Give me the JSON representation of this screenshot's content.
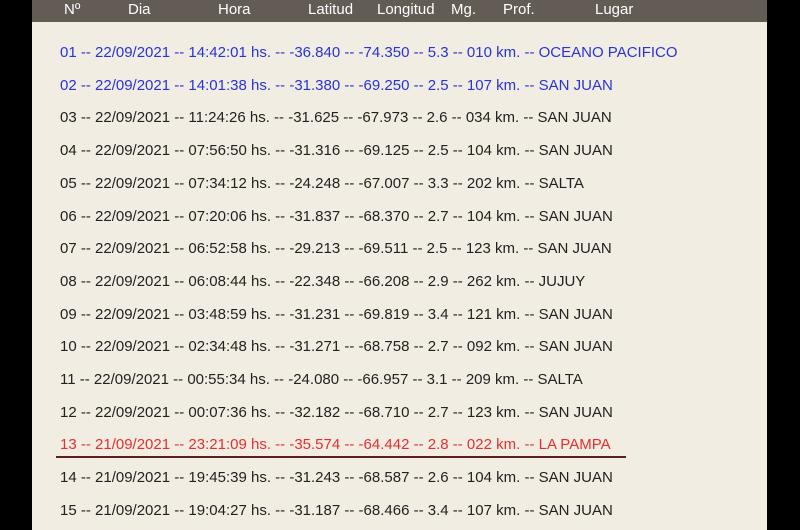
{
  "header": {
    "col_num": "Nº",
    "col_day": "Dia",
    "col_time": "Hora",
    "col_lat": "Latitud",
    "col_lon": "Longitud",
    "col_mag": "Mg.",
    "col_depth": "Prof.",
    "col_place": "Lugar"
  },
  "colors": {
    "header_bg": "#625c55",
    "page_bg": "#f1ede3",
    "highlight_blue": "#2a33d6",
    "highlight_red": "#e2302f",
    "text": "#222222"
  },
  "rows": [
    {
      "num": "01",
      "date": "22/09/2021",
      "time": "14:42:01",
      "lat": "-36.840",
      "lon": "-74.350",
      "mag": "5.3",
      "depth": "010",
      "place": "OCEANO PACIFICO",
      "style": "blue"
    },
    {
      "num": "02",
      "date": "22/09/2021",
      "time": "14:01:38",
      "lat": "-31.380",
      "lon": "-69.250",
      "mag": "2.5",
      "depth": "107",
      "place": "SAN JUAN",
      "style": "blue"
    },
    {
      "num": "03",
      "date": "22/09/2021",
      "time": "11:24:26",
      "lat": "-31.625",
      "lon": "-67.973",
      "mag": "2.6",
      "depth": "034",
      "place": "SAN JUAN",
      "style": "normal"
    },
    {
      "num": "04",
      "date": "22/09/2021",
      "time": "07:56:50",
      "lat": "-31.316",
      "lon": "-69.125",
      "mag": "2.5",
      "depth": "104",
      "place": "SAN JUAN",
      "style": "normal"
    },
    {
      "num": "05",
      "date": "22/09/2021",
      "time": "07:34:12",
      "lat": "-24.248",
      "lon": "-67.007",
      "mag": "3.3",
      "depth": "202",
      "place": "SALTA",
      "style": "normal"
    },
    {
      "num": "06",
      "date": "22/09/2021",
      "time": "07:20:06",
      "lat": "-31.837",
      "lon": "-68.370",
      "mag": "2.7",
      "depth": "104",
      "place": "SAN JUAN",
      "style": "normal"
    },
    {
      "num": "07",
      "date": "22/09/2021",
      "time": "06:52:58",
      "lat": "-29.213",
      "lon": "-69.511",
      "mag": "2.5",
      "depth": "123",
      "place": "SAN JUAN",
      "style": "normal"
    },
    {
      "num": "08",
      "date": "22/09/2021",
      "time": "06:08:44",
      "lat": "-22.348",
      "lon": "-66.208",
      "mag": "2.9",
      "depth": "262",
      "place": "JUJUY",
      "style": "normal"
    },
    {
      "num": "09",
      "date": "22/09/2021",
      "time": "03:48:59",
      "lat": "-31.231",
      "lon": "-69.819",
      "mag": "3.4",
      "depth": "121",
      "place": "SAN JUAN",
      "style": "normal"
    },
    {
      "num": "10",
      "date": "22/09/2021",
      "time": "02:34:48",
      "lat": "-31.271",
      "lon": "-68.758",
      "mag": "2.7",
      "depth": "092",
      "place": "SAN JUAN",
      "style": "normal"
    },
    {
      "num": "11",
      "date": "22/09/2021",
      "time": "00:55:34",
      "lat": "-24.080",
      "lon": "-66.957",
      "mag": "3.1",
      "depth": "209",
      "place": "SALTA",
      "style": "normal"
    },
    {
      "num": "12",
      "date": "22/09/2021",
      "time": "00:07:36",
      "lat": "-32.182",
      "lon": "-68.710",
      "mag": "2.7",
      "depth": "123",
      "place": "SAN JUAN",
      "style": "normal"
    },
    {
      "num": "13",
      "date": "21/09/2021",
      "time": "23:21:09",
      "lat": "-35.574",
      "lon": "-64.442",
      "mag": "2.8",
      "depth": "022",
      "place": "LA PAMPA",
      "style": "red"
    },
    {
      "num": "14",
      "date": "21/09/2021",
      "time": "19:45:39",
      "lat": "-31.243",
      "lon": "-68.587",
      "mag": "2.6",
      "depth": "104",
      "place": "SAN JUAN",
      "style": "normal"
    },
    {
      "num": "15",
      "date": "21/09/2021",
      "time": "19:04:27",
      "lat": "-31.187",
      "lon": "-68.466",
      "mag": "3.4",
      "depth": "107",
      "place": "SAN JUAN",
      "style": "normal"
    }
  ],
  "separator": " -- ",
  "hours_suffix": "hs.",
  "km_suffix": "km."
}
